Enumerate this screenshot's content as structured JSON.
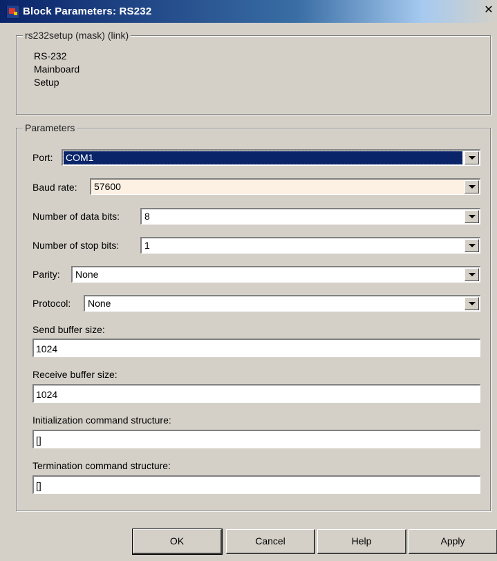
{
  "window": {
    "title": "Block Parameters: RS232",
    "close_glyph": "✕",
    "app_icon": "simulink-block-icon",
    "close_icon": "close-icon"
  },
  "description_group": {
    "legend": "rs232setup (mask) (link)",
    "lines": [
      "RS-232",
      "Mainboard",
      "Setup"
    ]
  },
  "parameters": {
    "legend": "Parameters",
    "port": {
      "label": "Port:",
      "value": "COM1"
    },
    "baud_rate": {
      "label": "Baud rate:",
      "value": "57600"
    },
    "data_bits": {
      "label": "Number of data bits:",
      "value": "8"
    },
    "stop_bits": {
      "label": "Number of stop bits:",
      "value": "1"
    },
    "parity": {
      "label": "Parity:",
      "value": "None"
    },
    "protocol": {
      "label": "Protocol:",
      "value": "None"
    },
    "send_buffer": {
      "label": "Send buffer size:",
      "value": "1024"
    },
    "receive_buffer": {
      "label": "Receive buffer size:",
      "value": "1024"
    },
    "init_command": {
      "label": "Initialization command structure:",
      "value": "[]"
    },
    "term_command": {
      "label": "Termination command structure:",
      "value": "[]"
    }
  },
  "buttons": {
    "ok": "OK",
    "cancel": "Cancel",
    "help": "Help",
    "apply": "Apply"
  },
  "colors": {
    "title_gradient_start": "#0a246a",
    "dialog_face": "#d4d0c8",
    "selection": "#0a246a",
    "baud_field_tint": "#fdf1e4"
  }
}
